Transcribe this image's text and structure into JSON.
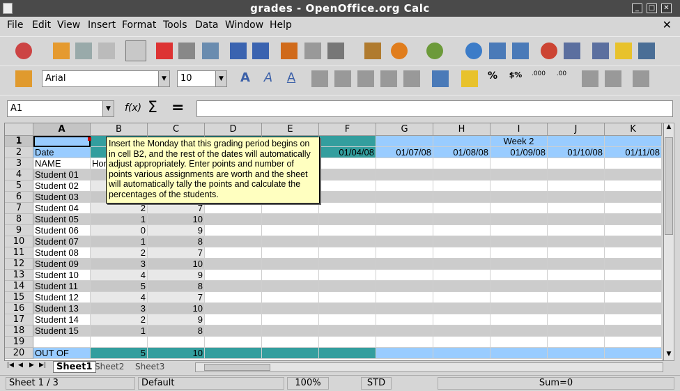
{
  "window": {
    "title": "grades - OpenOffice.org Calc"
  },
  "menu": [
    "File",
    "Edit",
    "View",
    "Insert",
    "Format",
    "Tools",
    "Data",
    "Window",
    "Help"
  ],
  "toolbar2": {
    "font_name": "Arial",
    "font_size": "10"
  },
  "formula": {
    "name_box": "A1",
    "fx": "f(x)",
    "sum": "Σ",
    "eq": "=",
    "content": ""
  },
  "columns": [
    "A",
    "B",
    "C",
    "D",
    "E",
    "F",
    "G",
    "H",
    "I",
    "J",
    "K"
  ],
  "rows": {
    "r1": {
      "num": "1",
      "I": "Week 2"
    },
    "r2": {
      "num": "2",
      "A": "Date",
      "F": "01/04/08",
      "G": "01/07/08",
      "H": "01/08/08",
      "I": "01/09/08",
      "J": "01/10/08",
      "K": "01/11/08"
    },
    "r3": {
      "num": "3",
      "A": "NAME",
      "B": "Hom"
    },
    "r4": {
      "num": "4",
      "A": "Student 01"
    },
    "r5": {
      "num": "5",
      "A": "Student 02"
    },
    "r6": {
      "num": "6",
      "A": "Student 03"
    },
    "r7": {
      "num": "7",
      "A": "Student 04",
      "B": "2",
      "C": "7"
    },
    "r8": {
      "num": "8",
      "A": "Student 05",
      "B": "1",
      "C": "10"
    },
    "r9": {
      "num": "9",
      "A": "Student 06",
      "B": "0",
      "C": "9"
    },
    "r10": {
      "num": "10",
      "A": "Student 07",
      "B": "1",
      "C": "8"
    },
    "r11": {
      "num": "11",
      "A": "Student 08",
      "B": "2",
      "C": "7"
    },
    "r12": {
      "num": "12",
      "A": "Student 09",
      "B": "3",
      "C": "10"
    },
    "r13": {
      "num": "13",
      "A": "Student 10",
      "B": "4",
      "C": "9"
    },
    "r14": {
      "num": "14",
      "A": "Student 11",
      "B": "5",
      "C": "8"
    },
    "r15": {
      "num": "15",
      "A": "Student 12",
      "B": "4",
      "C": "7"
    },
    "r16": {
      "num": "16",
      "A": "Student 13",
      "B": "3",
      "C": "10"
    },
    "r17": {
      "num": "17",
      "A": "Student 14",
      "B": "2",
      "C": "9"
    },
    "r18": {
      "num": "18",
      "A": "Student 15",
      "B": "1",
      "C": "8"
    },
    "r19": {
      "num": "19"
    },
    "r20": {
      "num": "20",
      "A": "OUT OF",
      "B": "5",
      "C": "10"
    }
  },
  "note": "Insert the Monday that this grading period begins on in cell B2, and the rest of the dates will automatically adjust appropriately. Enter points and number of points various assignments are worth and the sheet will automatically tally the points and calculate the percentages of the students.",
  "sheets": [
    "Sheet1",
    "Sheet2",
    "Sheet3"
  ],
  "status": {
    "sheet": "Sheet 1 / 3",
    "style": "Default",
    "zoom": "100%",
    "mode": "STD",
    "sum": "Sum=0"
  },
  "colors": {
    "teal": "#339e9e",
    "lightblue": "#99ccff",
    "gray_band": "#cccccc",
    "note_bg": "#ffffc0"
  }
}
